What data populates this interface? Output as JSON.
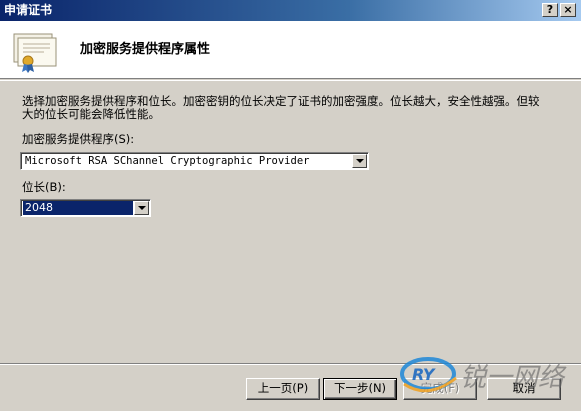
{
  "window": {
    "title": "申请证书",
    "help_glyph": "?",
    "close_glyph": "×"
  },
  "header": {
    "title": "加密服务提供程序属性",
    "icon": "certificate-icon"
  },
  "body": {
    "description": "选择加密服务提供程序和位长。加密密钥的位长决定了证书的加密强度。位长越大，安全性越强。但较大的位长可能会降低性能。",
    "csp_label": "加密服务提供程序(S):",
    "csp_value": "Microsoft RSA SChannel Cryptographic Provider",
    "bits_label": "位长(B):",
    "bits_value": "2048"
  },
  "buttons": {
    "back": "上一页(P)",
    "next": "下一步(N)",
    "finish": "完成(F)",
    "cancel": "取消"
  },
  "watermark": {
    "logo": "RY",
    "text": "锐一网络"
  },
  "colors": {
    "title_bar": "#0a246a",
    "face": "#d4d0c8",
    "selection": "#0a246a"
  }
}
